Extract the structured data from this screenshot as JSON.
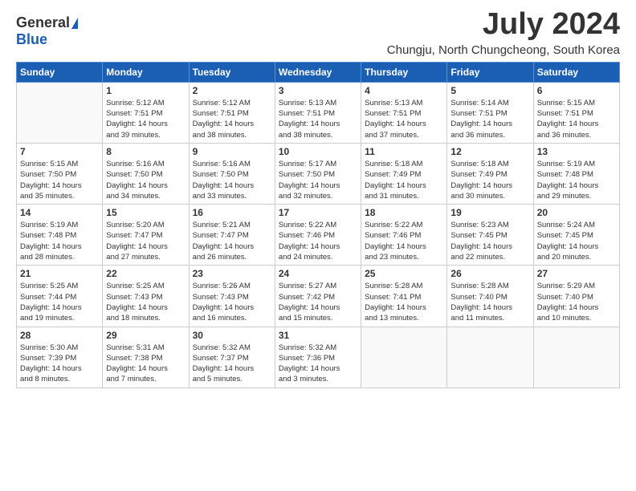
{
  "header": {
    "logo_general": "General",
    "logo_blue": "Blue",
    "month_title": "July 2024",
    "location": "Chungju, North Chungcheong, South Korea"
  },
  "calendar": {
    "days_of_week": [
      "Sunday",
      "Monday",
      "Tuesday",
      "Wednesday",
      "Thursday",
      "Friday",
      "Saturday"
    ],
    "weeks": [
      [
        {
          "day": "",
          "info": ""
        },
        {
          "day": "1",
          "info": "Sunrise: 5:12 AM\nSunset: 7:51 PM\nDaylight: 14 hours\nand 39 minutes."
        },
        {
          "day": "2",
          "info": "Sunrise: 5:12 AM\nSunset: 7:51 PM\nDaylight: 14 hours\nand 38 minutes."
        },
        {
          "day": "3",
          "info": "Sunrise: 5:13 AM\nSunset: 7:51 PM\nDaylight: 14 hours\nand 38 minutes."
        },
        {
          "day": "4",
          "info": "Sunrise: 5:13 AM\nSunset: 7:51 PM\nDaylight: 14 hours\nand 37 minutes."
        },
        {
          "day": "5",
          "info": "Sunrise: 5:14 AM\nSunset: 7:51 PM\nDaylight: 14 hours\nand 36 minutes."
        },
        {
          "day": "6",
          "info": "Sunrise: 5:15 AM\nSunset: 7:51 PM\nDaylight: 14 hours\nand 36 minutes."
        }
      ],
      [
        {
          "day": "7",
          "info": "Sunrise: 5:15 AM\nSunset: 7:50 PM\nDaylight: 14 hours\nand 35 minutes."
        },
        {
          "day": "8",
          "info": "Sunrise: 5:16 AM\nSunset: 7:50 PM\nDaylight: 14 hours\nand 34 minutes."
        },
        {
          "day": "9",
          "info": "Sunrise: 5:16 AM\nSunset: 7:50 PM\nDaylight: 14 hours\nand 33 minutes."
        },
        {
          "day": "10",
          "info": "Sunrise: 5:17 AM\nSunset: 7:50 PM\nDaylight: 14 hours\nand 32 minutes."
        },
        {
          "day": "11",
          "info": "Sunrise: 5:18 AM\nSunset: 7:49 PM\nDaylight: 14 hours\nand 31 minutes."
        },
        {
          "day": "12",
          "info": "Sunrise: 5:18 AM\nSunset: 7:49 PM\nDaylight: 14 hours\nand 30 minutes."
        },
        {
          "day": "13",
          "info": "Sunrise: 5:19 AM\nSunset: 7:48 PM\nDaylight: 14 hours\nand 29 minutes."
        }
      ],
      [
        {
          "day": "14",
          "info": "Sunrise: 5:19 AM\nSunset: 7:48 PM\nDaylight: 14 hours\nand 28 minutes."
        },
        {
          "day": "15",
          "info": "Sunrise: 5:20 AM\nSunset: 7:47 PM\nDaylight: 14 hours\nand 27 minutes."
        },
        {
          "day": "16",
          "info": "Sunrise: 5:21 AM\nSunset: 7:47 PM\nDaylight: 14 hours\nand 26 minutes."
        },
        {
          "day": "17",
          "info": "Sunrise: 5:22 AM\nSunset: 7:46 PM\nDaylight: 14 hours\nand 24 minutes."
        },
        {
          "day": "18",
          "info": "Sunrise: 5:22 AM\nSunset: 7:46 PM\nDaylight: 14 hours\nand 23 minutes."
        },
        {
          "day": "19",
          "info": "Sunrise: 5:23 AM\nSunset: 7:45 PM\nDaylight: 14 hours\nand 22 minutes."
        },
        {
          "day": "20",
          "info": "Sunrise: 5:24 AM\nSunset: 7:45 PM\nDaylight: 14 hours\nand 20 minutes."
        }
      ],
      [
        {
          "day": "21",
          "info": "Sunrise: 5:25 AM\nSunset: 7:44 PM\nDaylight: 14 hours\nand 19 minutes."
        },
        {
          "day": "22",
          "info": "Sunrise: 5:25 AM\nSunset: 7:43 PM\nDaylight: 14 hours\nand 18 minutes."
        },
        {
          "day": "23",
          "info": "Sunrise: 5:26 AM\nSunset: 7:43 PM\nDaylight: 14 hours\nand 16 minutes."
        },
        {
          "day": "24",
          "info": "Sunrise: 5:27 AM\nSunset: 7:42 PM\nDaylight: 14 hours\nand 15 minutes."
        },
        {
          "day": "25",
          "info": "Sunrise: 5:28 AM\nSunset: 7:41 PM\nDaylight: 14 hours\nand 13 minutes."
        },
        {
          "day": "26",
          "info": "Sunrise: 5:28 AM\nSunset: 7:40 PM\nDaylight: 14 hours\nand 11 minutes."
        },
        {
          "day": "27",
          "info": "Sunrise: 5:29 AM\nSunset: 7:40 PM\nDaylight: 14 hours\nand 10 minutes."
        }
      ],
      [
        {
          "day": "28",
          "info": "Sunrise: 5:30 AM\nSunset: 7:39 PM\nDaylight: 14 hours\nand 8 minutes."
        },
        {
          "day": "29",
          "info": "Sunrise: 5:31 AM\nSunset: 7:38 PM\nDaylight: 14 hours\nand 7 minutes."
        },
        {
          "day": "30",
          "info": "Sunrise: 5:32 AM\nSunset: 7:37 PM\nDaylight: 14 hours\nand 5 minutes."
        },
        {
          "day": "31",
          "info": "Sunrise: 5:32 AM\nSunset: 7:36 PM\nDaylight: 14 hours\nand 3 minutes."
        },
        {
          "day": "",
          "info": ""
        },
        {
          "day": "",
          "info": ""
        },
        {
          "day": "",
          "info": ""
        }
      ]
    ]
  }
}
